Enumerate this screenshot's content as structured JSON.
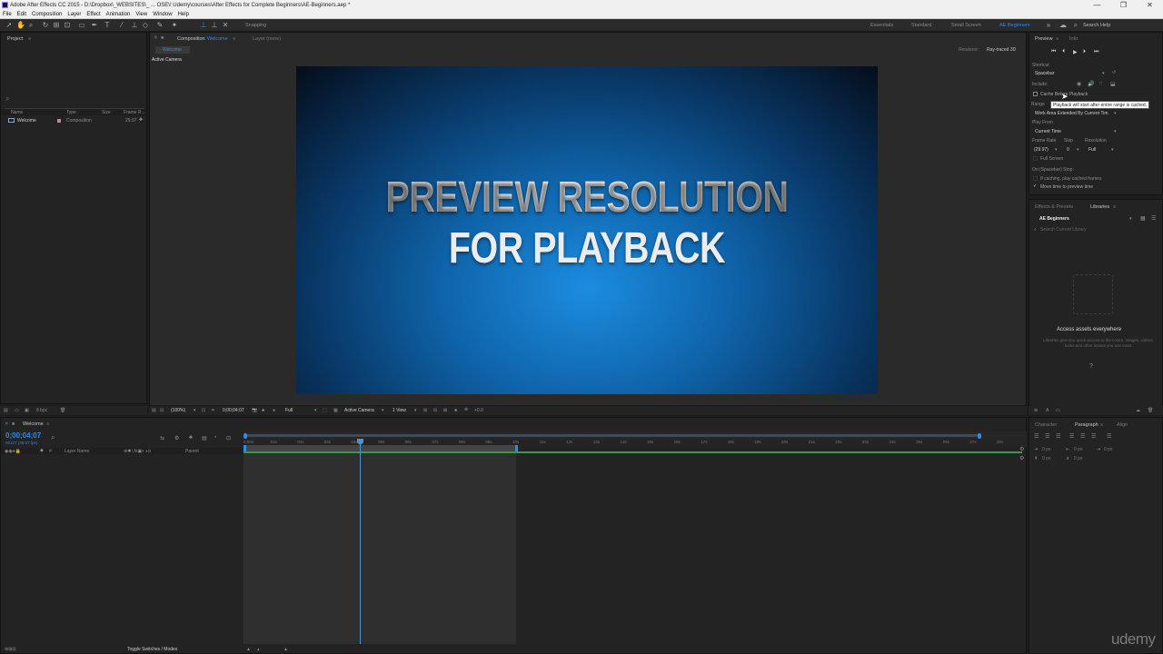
{
  "window": {
    "title": "Adobe After Effects CC 2015 - D:\\Dropbox\\_WEBSITES\\_ ... OSE\\! Udemy\\courses\\After Effects for Complete Beginners\\AE-Beginners.aep *",
    "controls": [
      "—",
      "❐",
      "✕"
    ]
  },
  "menu": [
    "File",
    "Edit",
    "Composition",
    "Layer",
    "Effect",
    "Animation",
    "View",
    "Window",
    "Help"
  ],
  "toolbar": {
    "snapping": "Snapping",
    "workspaces": [
      "Essentials",
      "Standard",
      "Small Screen",
      "AE Beginners"
    ],
    "active_workspace": "AE Beginners",
    "search_help": "Search Help"
  },
  "project": {
    "tab": "Project",
    "columns": [
      "Name",
      "Type",
      "Size",
      "Frame R..."
    ],
    "items": [
      {
        "name": "Welcome",
        "type": "Composition",
        "frame_rate": "29.97"
      }
    ],
    "bpc": "8 bpc"
  },
  "composition": {
    "tab_label": "Composition",
    "tab_comp": "Welcome",
    "layer_tab": "Layer (none)",
    "subtab": "Welcome",
    "renderer_label": "Renderer:",
    "renderer_value": "Ray-traced 3D",
    "view_label": "Active Camera",
    "headline_line1": "PREVIEW RESOLUTION",
    "headline_line2": "FOR PLAYBACK",
    "footer": {
      "zoom": "(100%)",
      "timecode": "0;00;04;07",
      "resolution": "Full",
      "camera": "Active Camera",
      "views": "1 View",
      "offset": "+0.0"
    }
  },
  "preview": {
    "tab": "Preview",
    "info_tab": "Info",
    "shortcut_label": "Shortcut",
    "shortcut_value": "Spacebar",
    "include_label": "Include:",
    "cache_label": "Cache Before Playback",
    "tooltip": "Playback will start after entire range is cached.",
    "range_label": "Range",
    "range_value": "Work Area Extended By Current Tim",
    "play_from_label": "Play From",
    "play_from_value": "Current Time",
    "frame_rate_label": "Frame Rate",
    "skip_label": "Skip",
    "resolution_label": "Resolution",
    "frame_rate_value": "(29.97)",
    "skip_value": "0",
    "resolution_value": "Full",
    "full_screen": "Full Screen",
    "on_stop_label": "On (Spacebar) Stop:",
    "if_caching": "If caching, play cached frames",
    "move_time": "Move time to preview time"
  },
  "libraries": {
    "effects_tab": "Effects & Presets",
    "libraries_tab": "Libraries",
    "library_name": "AE Beginners",
    "search_placeholder": "Search Current Library",
    "heading": "Access assets everywhere",
    "description": "Libraries give you quick access to the colors, images, videos, looks and other assets you use most."
  },
  "character": {
    "tabs": [
      "Character",
      "Paragraph",
      "Align"
    ],
    "active_tab": "Paragraph",
    "indent_values": [
      "0 px",
      "0 px",
      "0 px",
      "0 px",
      "0 px"
    ]
  },
  "timeline": {
    "tab": "Welcome",
    "timecode": "0;00;04;07",
    "fps": "00127 (29.97 fps)",
    "col_layer_name": "Layer Name",
    "col_parent": "Parent",
    "toggle_label": "Toggle Switches / Modes",
    "ruler": [
      "0:00s",
      "01s",
      "02s",
      "03s",
      "04s",
      "05s",
      "06s",
      "07s",
      "08s",
      "09s",
      "10s",
      "11s",
      "12s",
      "13s",
      "14s",
      "15s",
      "16s",
      "17s",
      "18s",
      "19s",
      "20s",
      "21s",
      "22s",
      "23s",
      "24s",
      "25s",
      "26s",
      "27s",
      "28s"
    ]
  },
  "watermark": "udemy",
  "colors": {
    "accent": "#2d8ceb",
    "panel": "#232323",
    "canvas_center": "#1c8ce0",
    "canvas_edge": "#050d1a",
    "work_area": "#2f2f2f",
    "green_bar": "#3c9a3c"
  }
}
